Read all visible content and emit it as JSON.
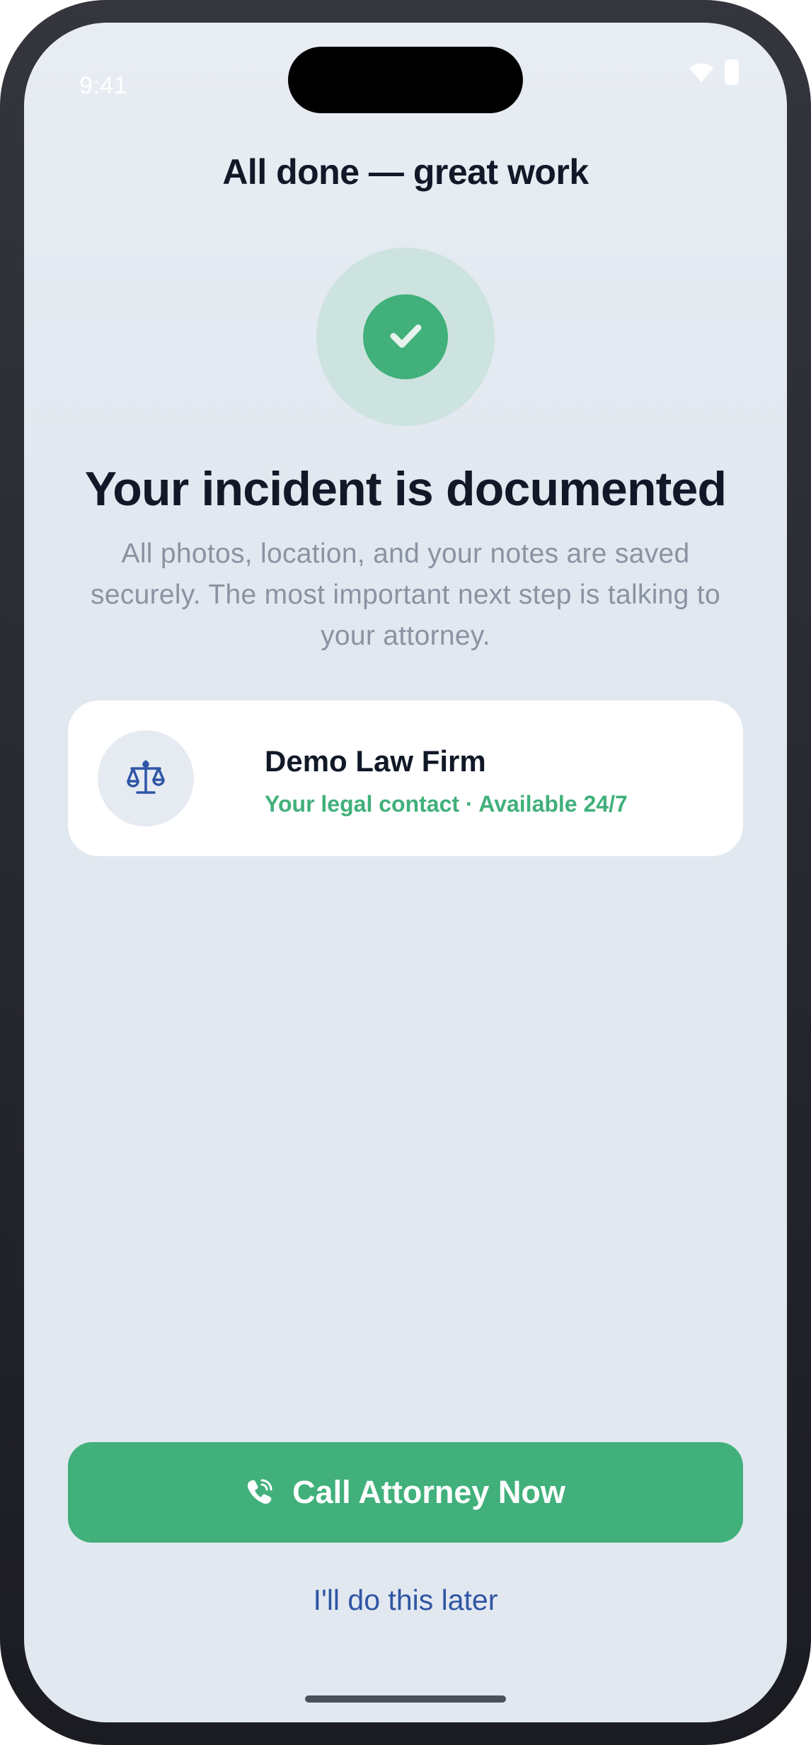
{
  "status_bar": {
    "time": "9:41",
    "icons": [
      "wifi-icon",
      "battery-icon"
    ]
  },
  "header": {
    "title": "All done — great work"
  },
  "success": {
    "icon": "checkmark-icon",
    "headline": "Your incident is documented",
    "message": "All photos, location, and your notes are saved securely. The most important next step is talking to your attorney."
  },
  "contact": {
    "icon": "scales-of-justice-icon",
    "name": "Demo Law Firm",
    "subtitle": "Your legal contact · Available 24/7"
  },
  "actions": {
    "call_icon": "phone-icon",
    "call_label": "Call Attorney Now",
    "later_label": "I'll do this later"
  },
  "colors": {
    "accent_green": "#41b07b",
    "success_ring": "#cde3df",
    "link_blue": "#2f55a4",
    "text_primary": "#111827",
    "text_secondary": "#8a93a2",
    "background": "#e2e8f0"
  }
}
